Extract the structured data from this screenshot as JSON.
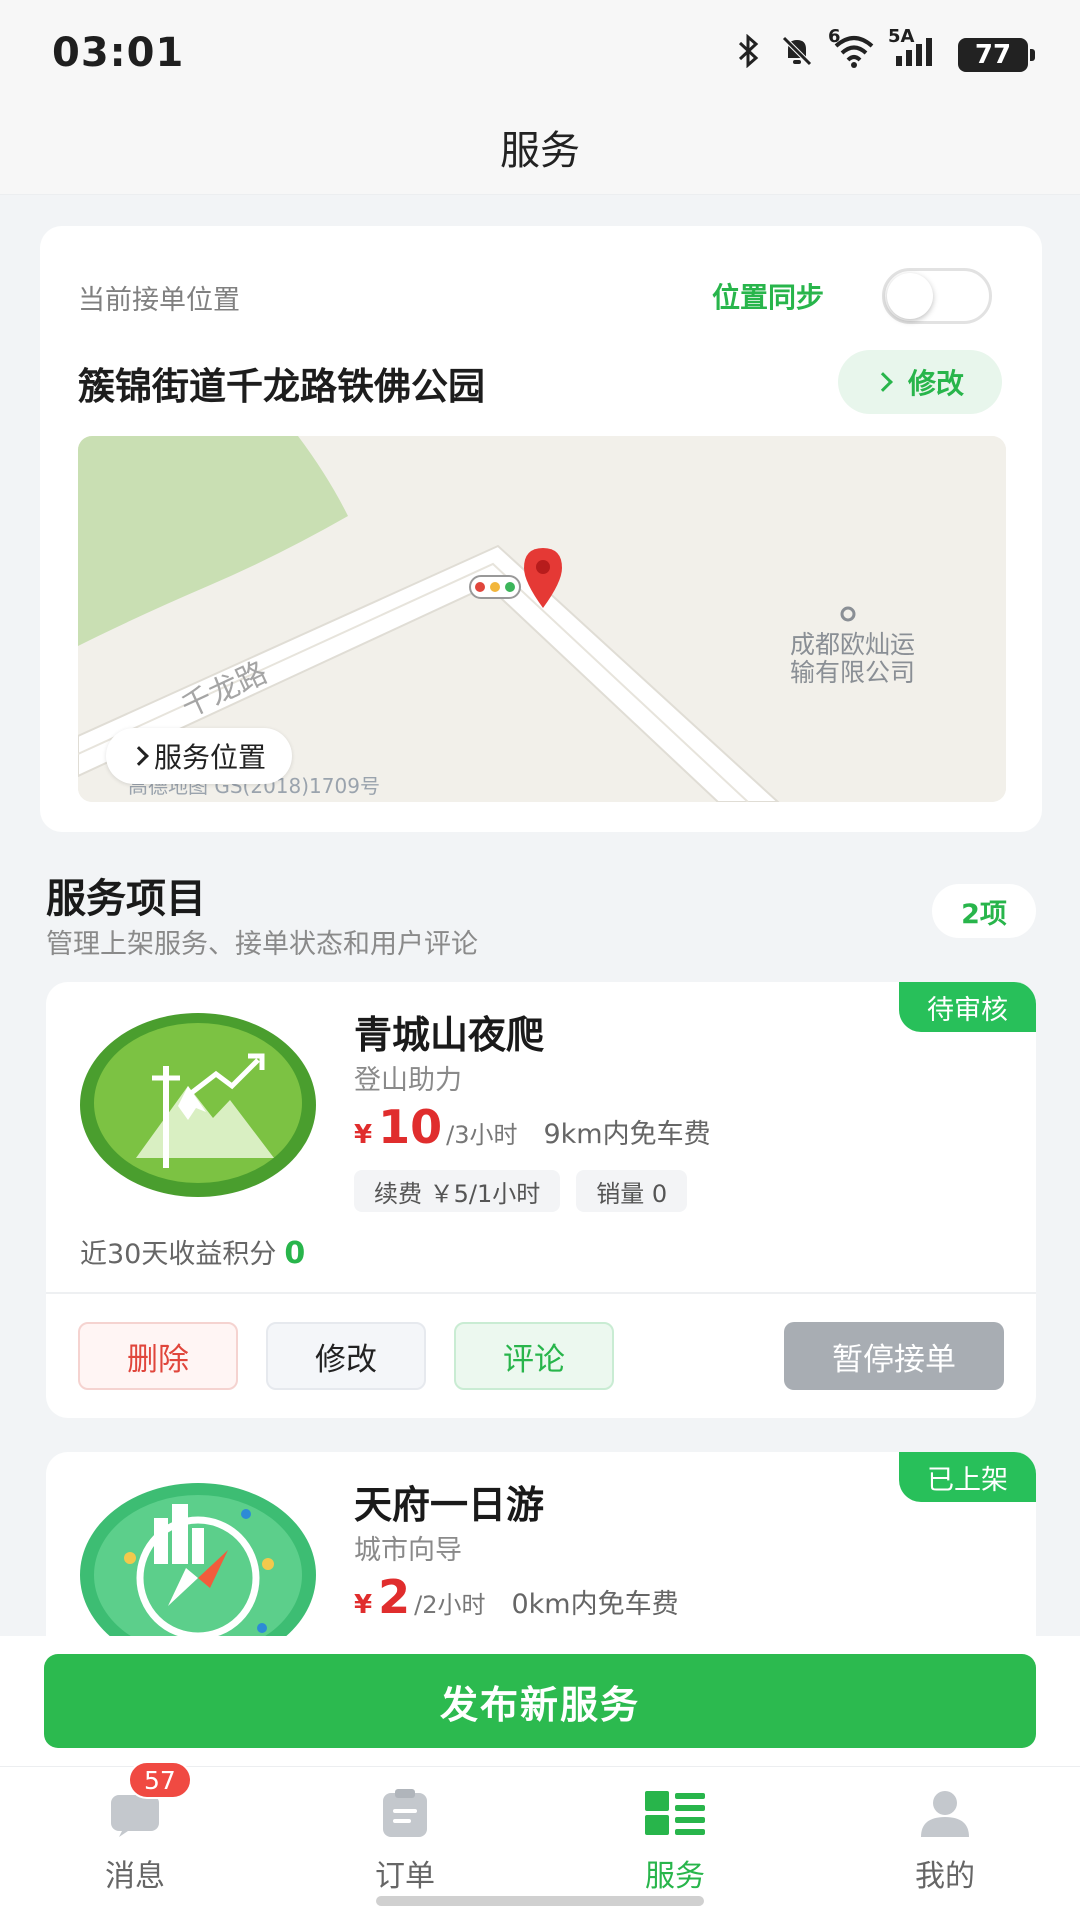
{
  "status_bar": {
    "time": "03:01",
    "signal_labels": [
      "6",
      "5A"
    ],
    "battery": "77"
  },
  "header": {
    "title": "服务"
  },
  "location": {
    "label": "当前接单位置",
    "sync_label": "位置同步",
    "sync_enabled": false,
    "address": "簇锦街道千龙路铁佛公园",
    "edit_label": "修改",
    "service_location_label": "服务位置",
    "map_poi": [
      "成都欧灿运",
      "输有限公司"
    ],
    "map_road": "千龙路",
    "map_watermark": "高德地图 GS(2018)1709号"
  },
  "section": {
    "title": "服务项目",
    "subtitle": "管理上架服务、接单状态和用户评论",
    "count": "2项"
  },
  "services": [
    {
      "status": "待审核",
      "name": "青城山夜爬",
      "category": "登山助力",
      "price_symbol": "¥",
      "price": "10",
      "price_unit": "/3小时",
      "free_distance": "9km内免车费",
      "renewal": "续费 ￥5/1小时",
      "sales": "销量 0",
      "earnings_label": "近30天收益积分",
      "earnings_value": "0",
      "actions": {
        "delete": "删除",
        "edit": "修改",
        "review": "评论",
        "pause": "暂停接单"
      },
      "icon": "mountain-icon"
    },
    {
      "status": "已上架",
      "name": "天府一日游",
      "category": "城市向导",
      "price_symbol": "¥",
      "price": "2",
      "price_unit": "/2小时",
      "free_distance": "0km内免车费",
      "icon": "compass-city-icon"
    }
  ],
  "publish_button": "发布新服务",
  "tabs": [
    {
      "label": "消息",
      "badge": "57",
      "icon": "message-icon"
    },
    {
      "label": "订单",
      "icon": "order-icon"
    },
    {
      "label": "服务",
      "icon": "service-grid-icon",
      "active": true
    },
    {
      "label": "我的",
      "icon": "profile-icon"
    }
  ],
  "colors": {
    "accent": "#28b54b",
    "price": "#e02d2d",
    "badge": "#f04a42",
    "pause": "#a8adb3"
  }
}
